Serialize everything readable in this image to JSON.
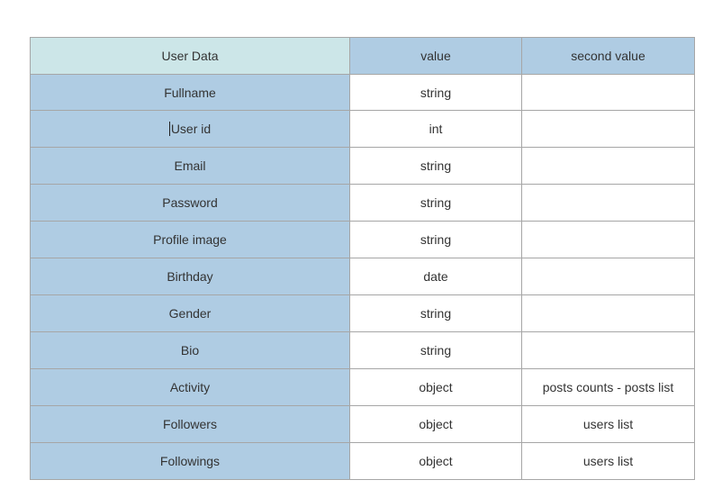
{
  "table": {
    "headers": [
      "User Data",
      "value",
      "second value"
    ],
    "rows": [
      [
        "Fullname",
        "string",
        ""
      ],
      [
        "User id",
        "int",
        ""
      ],
      [
        "Email",
        "string",
        ""
      ],
      [
        "Password",
        "string",
        ""
      ],
      [
        "Profile image",
        "string",
        ""
      ],
      [
        "Birthday",
        "date",
        ""
      ],
      [
        "Gender",
        "string",
        ""
      ],
      [
        "Bio",
        "string",
        ""
      ],
      [
        "Activity",
        "object",
        "posts counts - posts list"
      ],
      [
        "Followers",
        "object",
        "users list"
      ],
      [
        "Followings",
        "object",
        "users list"
      ]
    ]
  },
  "colors": {
    "header_first_bg": "#cce6e8",
    "header_bg": "#afcce3",
    "key_column_bg": "#afcce3",
    "border": "#a6a6a6"
  },
  "editing_cell": "User id"
}
